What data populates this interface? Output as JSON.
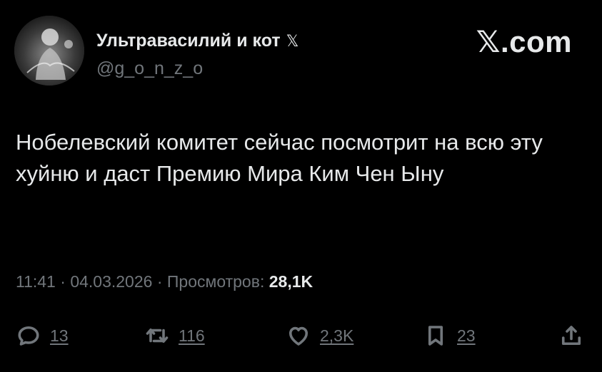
{
  "header": {
    "display_name": "Ультравасилий и кот",
    "badge": "𝕏",
    "handle": "@g_o_n_z_o",
    "brand": "𝕏.com"
  },
  "tweet": {
    "text": "Нобелевский комитет сейчас посмотрит на всю эту хуйню и даст Премию Мира Ким Чен Ыну"
  },
  "meta": {
    "time": "11:41",
    "separator1": " · ",
    "date": "04.03.2026",
    "separator2": " · ",
    "views_label": "Просмотров: ",
    "views_count": "28,1K"
  },
  "actions": {
    "replies": "13",
    "reposts": "116",
    "likes": "2,3K",
    "bookmarks": "23"
  },
  "icons": {
    "reply": "speech-bubble-icon",
    "repost": "repost-arrows-icon",
    "like": "heart-icon",
    "bookmark": "bookmark-icon",
    "share": "share-upload-icon"
  },
  "colors": {
    "background": "#000000",
    "text": "#e7e9ea",
    "secondary": "#71767b"
  }
}
